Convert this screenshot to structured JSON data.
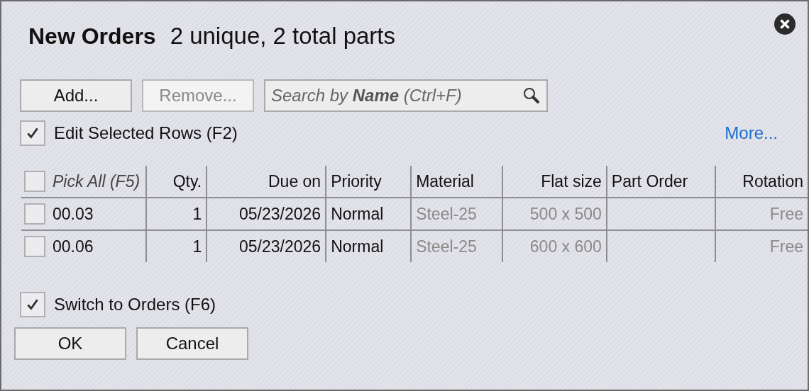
{
  "dialog": {
    "title": "New Orders",
    "subtitle": "2 unique, 2 total parts"
  },
  "toolbar": {
    "buttons": [
      {
        "label": "Add...",
        "disabled": false
      },
      {
        "label": "Remove...",
        "disabled": true
      }
    ],
    "search": {
      "placeholder": "Search by **Name** (Ctrl+F)"
    }
  },
  "edit_selected": {
    "label": "Edit Selected Rows (F2)",
    "checked": true
  },
  "more_link": "More...",
  "table": {
    "pick_all": {
      "label": "Pick All (F5)",
      "checked": false
    },
    "columns": [
      {
        "label": "Qty.",
        "dimmed": false
      },
      {
        "label": "Due on",
        "dimmed": false
      },
      {
        "label": "Priority",
        "dimmed": false
      },
      {
        "label": "Material",
        "dimmed": true
      },
      {
        "label": "Flat size",
        "dimmed": true
      },
      {
        "label": "Part Order"
      },
      {
        "label": "Rotation",
        "dimmed": true
      }
    ],
    "rows": [
      {
        "name": "00.03",
        "checked": false,
        "cells": [
          "1",
          "05/23/2026",
          "Normal",
          "Steel-25",
          "500 x 500",
          "",
          "Free"
        ]
      },
      {
        "name": "00.06",
        "checked": false,
        "cells": [
          "1",
          "05/23/2026",
          "Normal",
          "Steel-25",
          "600 x 600",
          "",
          "Free"
        ]
      }
    ]
  },
  "switch_orders": {
    "label": "Switch to Orders (F6)",
    "checked": true
  },
  "footer_buttons": [
    "OK",
    "Cancel"
  ]
}
